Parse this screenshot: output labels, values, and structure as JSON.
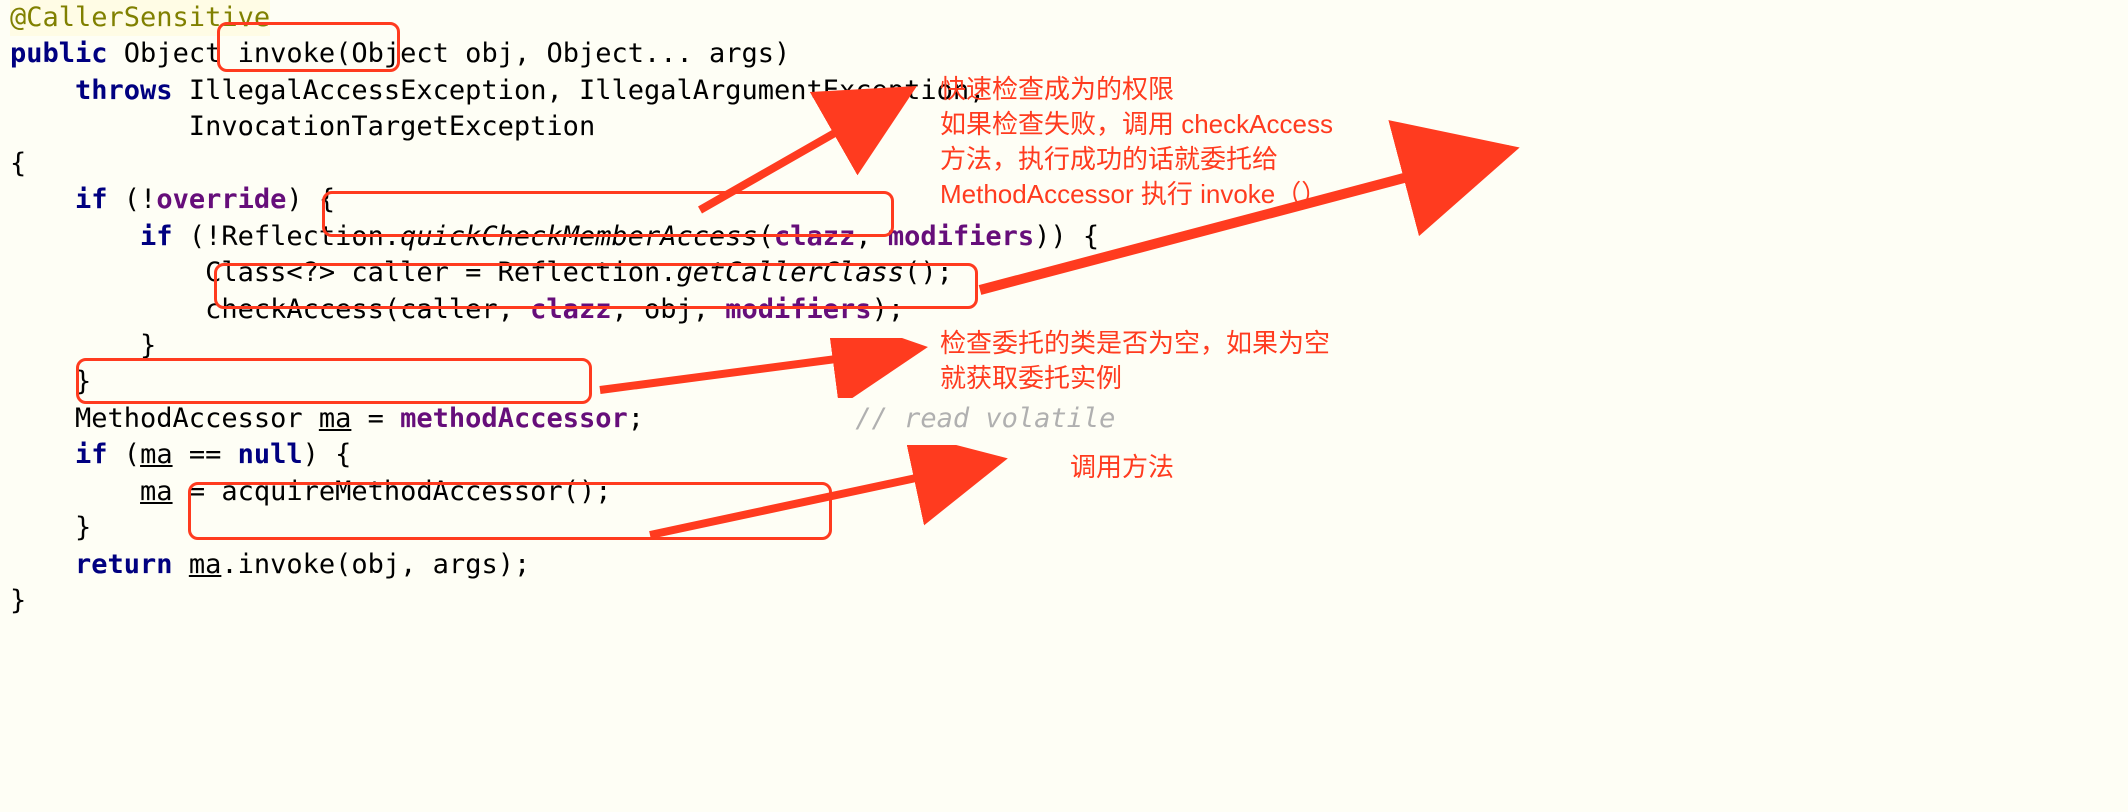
{
  "code": {
    "l1_anno": "@CallerSensitive",
    "l2_a": "public",
    "l2_b": " Object ",
    "l2_c": "invoke",
    "l2_d": "(Object obj, Object... args)",
    "l3_a": "throws",
    "l3_b": " IllegalAccessException, IllegalArgumentException,",
    "l4": "           InvocationTargetException",
    "l5": "{",
    "l6_a": "if",
    "l6_b": " (!",
    "l6_c": "override",
    "l6_d": ") {",
    "l7_a": "if",
    "l7_b": " (!Reflection.",
    "l7_c": "quickCheckMemberAccess",
    "l7_d": "(",
    "l7_e": "clazz",
    "l7_f": ", ",
    "l7_g": "modifiers",
    "l7_h": ")) {",
    "l8_a": "            Class<?> caller = Reflection.",
    "l8_b": "getCallerClass",
    "l8_c": "();",
    "l9_a": "            checkAccess(caller, ",
    "l9_b": "clazz",
    "l9_c": ", obj, ",
    "l9_d": "modifiers",
    "l9_e": ");",
    "l10": "        }",
    "l11": "    }",
    "l12_a": "    MethodAccessor ",
    "l12_b": "ma",
    "l12_c": " = ",
    "l12_d": "methodAccessor",
    "l12_e": ";",
    "l12_comment": "// read volatile",
    "l13_a": "if",
    "l13_b": " (",
    "l13_c": "ma",
    "l13_d": " == ",
    "l13_e": "null",
    "l13_f": ") {",
    "l14_a": "ma",
    "l14_b": " = acquireMethodAccessor();",
    "l15": "    }",
    "l16_a": "return",
    "l16_b": " ",
    "l16_c": "ma",
    "l16_d": ".invoke(obj, args);",
    "l17": "}"
  },
  "notes": {
    "n1": "快速检查成为的权限\n如果检查失败，调用 checkAccess\n方法，执行成功的话就委托给\nMethodAccessor 执行 invoke（）",
    "n2": "检查委托的类是否为空，如果为空\n就获取委托实例",
    "n3": "调用方法"
  },
  "colors": {
    "annotation": "#ff3b1f",
    "keyword": "#000080",
    "field": "#660e7a"
  }
}
